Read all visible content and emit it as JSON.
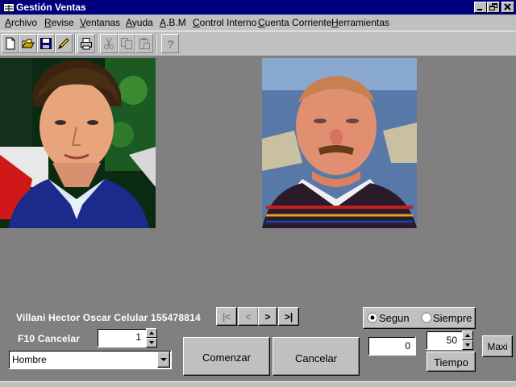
{
  "window": {
    "title": "Gestión Ventas"
  },
  "menu": {
    "items": [
      {
        "first": "A",
        "rest": "rchivo"
      },
      {
        "first": "R",
        "rest": "evise"
      },
      {
        "first": "V",
        "rest": "entanas"
      },
      {
        "first": "A",
        "rest": "yuda"
      },
      {
        "first": "A",
        "rest": ".B.M"
      },
      {
        "first": "C",
        "rest": "ontrol Interno"
      },
      {
        "first": "C",
        "rest": "uenta Corriente"
      },
      {
        "first": "H",
        "rest": "erramientas"
      }
    ]
  },
  "toolbar": {
    "icons": [
      "new-file-icon",
      "open-folder-icon",
      "save-disk-icon",
      "edit-pencil-icon",
      "print-icon",
      "cut-icon",
      "copy-icon",
      "paste-icon",
      "help-icon"
    ]
  },
  "bottom": {
    "person_info": "Villani Hector Oscar  Celular 155478814",
    "cancel_hint": "F10 Cancelar",
    "counter_value": "1",
    "gender_select": "Hombre",
    "nav": {
      "first": "|<",
      "prev": "<",
      "next": ">",
      "last": ">|"
    },
    "start_label": "Comenzar",
    "cancel_label": "Cancelar",
    "radio_segun": "Segun",
    "radio_siempre": "Siempre",
    "radio_selected": "Segun",
    "score_value": "0",
    "time_value": "50",
    "time_label": "Tiempo",
    "maxi_label": "Maxi"
  }
}
